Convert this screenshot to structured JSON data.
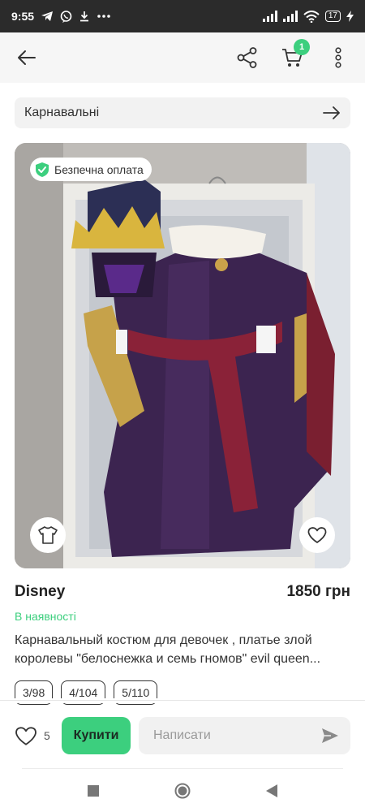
{
  "status_bar": {
    "time": "9:55",
    "battery": "17"
  },
  "app_bar": {
    "cart_count": "1"
  },
  "category": {
    "label": "Карнавальні"
  },
  "listing": {
    "safe_payment_badge": "Безпечна оплата",
    "brand": "Disney",
    "price": "1850 грн",
    "availability": "В наявності",
    "description_line1": "Карнавальный костюм для девочек , платье злой",
    "description_line2": "королевы \"белоснежка и семь гномов\" evil queen...",
    "sizes": [
      "3/98",
      "4/104",
      "5/110"
    ]
  },
  "bottom_bar": {
    "like_count": "5",
    "buy_label": "Купити",
    "message_placeholder": "Написати"
  },
  "colors": {
    "accent": "#3ccf7e",
    "status_bar_bg": "#2b2b2b",
    "app_bar_bg": "#f6f6f6"
  }
}
